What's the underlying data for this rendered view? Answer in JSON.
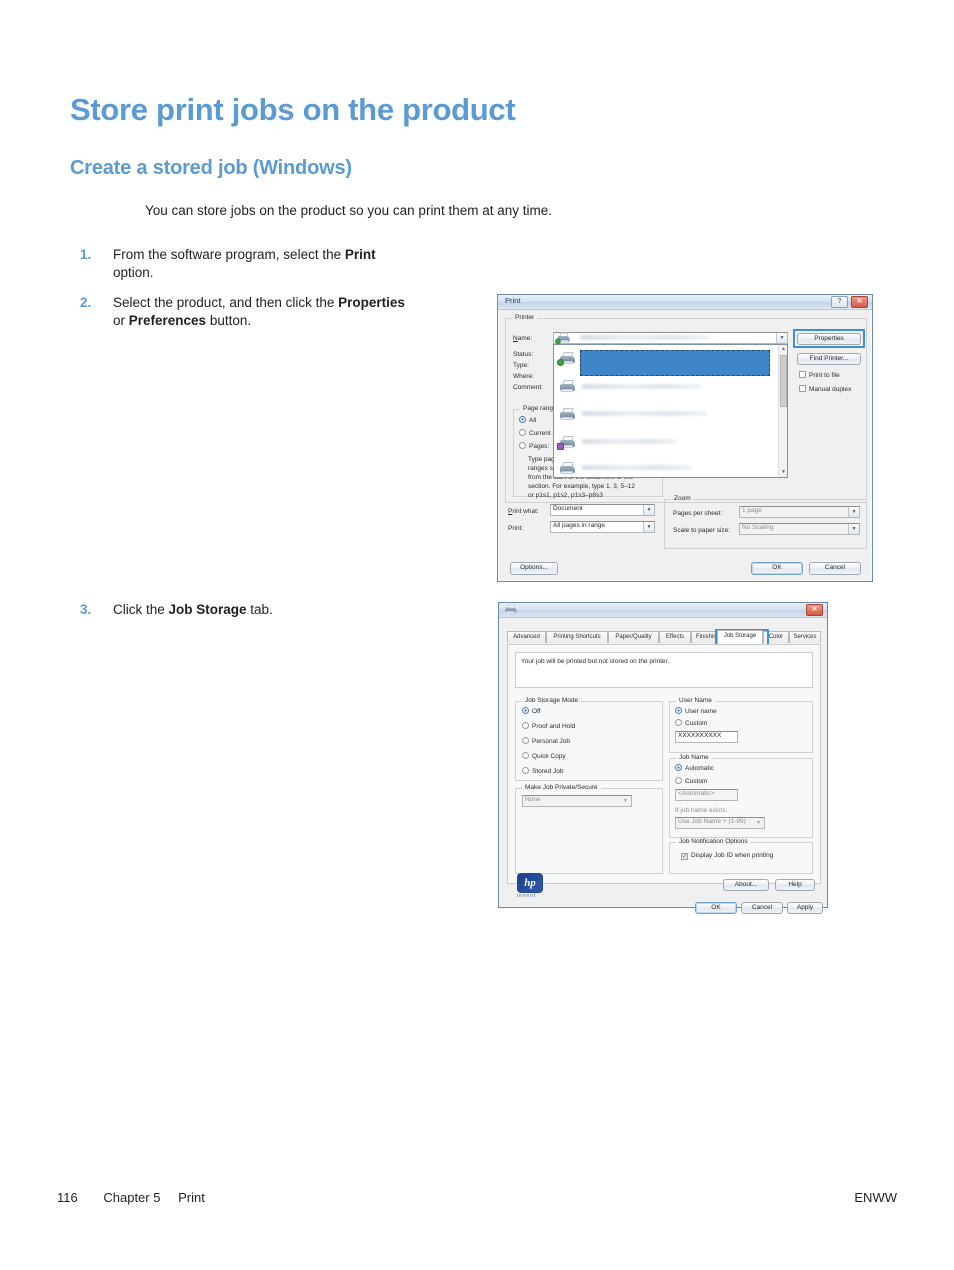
{
  "document": {
    "title": "Store print jobs on the product",
    "subtitle": "Create a stored job (Windows)",
    "intro": "You can store jobs on the product so you can print them at any time.",
    "accent_color": "#5b9bd5",
    "steps": [
      {
        "num": "1.",
        "text_before": "From the software program, select the ",
        "bold": "Print",
        "text_after": " option."
      },
      {
        "num": "2.",
        "text_before": "Select the product, and then click the ",
        "bold": "Properties",
        "mid": " or ",
        "bold2": "Preferences",
        "text_after": " button."
      },
      {
        "num": "3.",
        "text_before": "Click the ",
        "bold": "Job Storage",
        "text_after": " tab."
      }
    ],
    "footer": {
      "page_number": "116",
      "chapter": "Chapter 5",
      "section": "Print",
      "right": "ENWW"
    }
  },
  "print_dialog": {
    "title": "Print",
    "help_button": "?",
    "close_button": "✕",
    "printer_group": "Printer",
    "labels": {
      "name": "Name:",
      "status": "Status:",
      "type": "Type:",
      "where": "Where:",
      "comment": "Comment:"
    },
    "buttons": {
      "properties": "Properties",
      "find_printer": "Find Printer...",
      "options": "Options...",
      "ok": "OK",
      "cancel": "Cancel"
    },
    "checkboxes": {
      "print_to_file": "Print to file",
      "manual_duplex": "Manual duplex"
    },
    "page_range": {
      "group": "Page range",
      "all": "All",
      "current": "Current page",
      "pages": "Pages:",
      "hint_lines": [
        "Type page numbers and/or page",
        "ranges separated by commas counting",
        "from the start of the document or the",
        "section. For example, type 1, 3, 5–12",
        "or p1s1, p1s2, p1s3–p8s3"
      ]
    },
    "print_what": {
      "label": "Print what:",
      "value": "Document"
    },
    "print": {
      "label": "Print:",
      "value": "All pages in range"
    },
    "zoom_group": {
      "group": "Zoom",
      "pages_per_sheet": {
        "label": "Pages per sheet:",
        "value": "1 page"
      },
      "scale_to_paper": {
        "label": "Scale to paper size:",
        "value": "No Scaling"
      }
    },
    "dropdown_open": true,
    "printer_list_redacted": true
  },
  "job_storage_dialog": {
    "close_button": "✕",
    "tabs": [
      {
        "label": "Advanced",
        "active": false
      },
      {
        "label": "Printing Shortcuts",
        "active": false
      },
      {
        "label": "Paper/Quality",
        "active": false
      },
      {
        "label": "Effects",
        "active": false
      },
      {
        "label": "Finishing",
        "active": false
      },
      {
        "label": "Job Storage",
        "active": true
      },
      {
        "label": "Color",
        "active": false
      },
      {
        "label": "Services",
        "active": false
      }
    ],
    "status_message": "Your job will be printed but not stored on the printer.",
    "job_storage_mode": {
      "group": "Job Storage Mode",
      "options": [
        {
          "label": "Off",
          "selected": true
        },
        {
          "label": "Proof and Hold",
          "selected": false
        },
        {
          "label": "Personal Job",
          "selected": false
        },
        {
          "label": "Quick Copy",
          "selected": false
        },
        {
          "label": "Stored Job",
          "selected": false
        }
      ]
    },
    "make_private": {
      "group": "Make Job Private/Secure",
      "value": "None"
    },
    "user_name": {
      "group": "User Name",
      "options": [
        {
          "label": "User name",
          "selected": true
        },
        {
          "label": "Custom",
          "selected": false
        }
      ],
      "value": "XXXXXXXXXX"
    },
    "job_name": {
      "group": "Job Name",
      "options": [
        {
          "label": "Automatic",
          "selected": true
        },
        {
          "label": "Custom",
          "selected": false
        }
      ],
      "value": "<Automatic>",
      "exists_label": "If job name exists:",
      "exists_value": "Use Job Name + (1-99)"
    },
    "notification": {
      "group": "Job Notification Options",
      "checkbox": {
        "label": "Display Job ID when printing",
        "checked": true
      }
    },
    "brand": "hp",
    "brand_dots": "invent",
    "buttons": {
      "about": "About...",
      "help": "Help",
      "ok": "OK",
      "cancel": "Cancel",
      "apply": "Apply"
    }
  }
}
